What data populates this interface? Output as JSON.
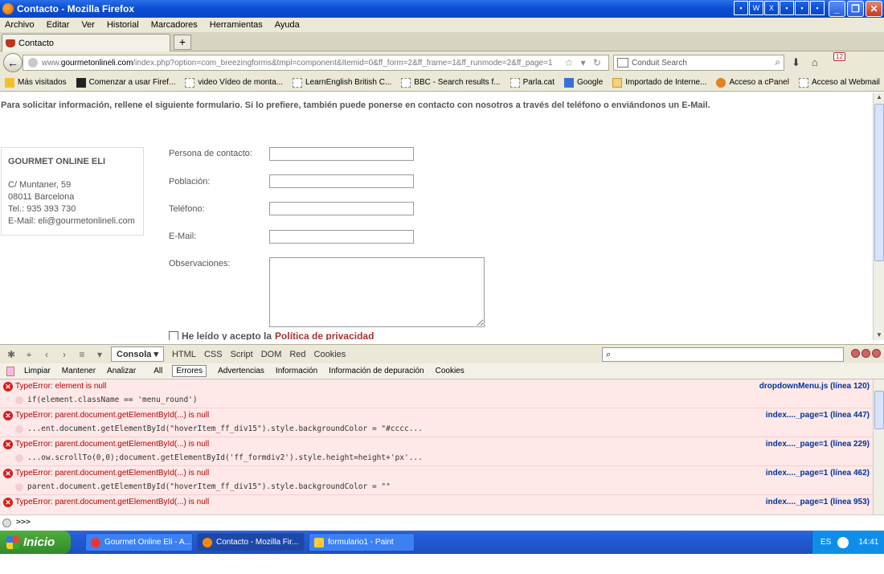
{
  "window": {
    "title": "Contacto - Mozilla Firefox"
  },
  "menu": [
    "Archivo",
    "Editar",
    "Ver",
    "Historial",
    "Marcadores",
    "Herramientas",
    "Ayuda"
  ],
  "tab": {
    "label": "Contacto",
    "new_tab_label": "+"
  },
  "address": {
    "prefix": "www.",
    "domain": "gourmetonlineli.com",
    "path": "/index.php?option=com_breezingforms&tmpl=component&Itemid=0&ff_form=2&ff_frame=1&ff_runmode=2&ff_page=1",
    "search_placeholder": "Conduit Search",
    "badge": "12"
  },
  "bookmarks": [
    {
      "label": "Más visitados",
      "icon": "star"
    },
    {
      "label": "Comenzar a usar Firef...",
      "icon": "m"
    },
    {
      "label": "video Vídeo de monta...",
      "icon": "page"
    },
    {
      "label": "LearnEnglish  British C...",
      "icon": "page"
    },
    {
      "label": "BBC - Search results f...",
      "icon": "page"
    },
    {
      "label": "Parla.cat",
      "icon": "page"
    },
    {
      "label": "Google",
      "icon": "g"
    },
    {
      "label": "Importado de Interne...",
      "icon": "folder"
    },
    {
      "label": "Acceso a cPanel",
      "icon": "cp"
    },
    {
      "label": "Acceso al Webmail",
      "icon": "page"
    }
  ],
  "page": {
    "intro": "Para solicitar información, rellene el siguiente formulario. Si lo prefiere, también puede ponerse en contacto con nosotros  a través del teléfono o enviándonos un E-Mail.",
    "company": {
      "name": "GOURMET ONLINE ELI",
      "address": "C/ Muntaner, 59",
      "city": "08011 Barcelona",
      "phone": "Tel.: 935 393 730",
      "email": "E-Mail: eli@gourmetonlineli.com"
    },
    "form": {
      "contact_label": "Persona de contacto:",
      "town_label": "Población:",
      "phone_label": "Teléfono:",
      "email_label": "E-Mail:",
      "notes_label": "Observaciones:",
      "privacy_text": "He leído y acepto la",
      "privacy_link": "Política de privacidad"
    }
  },
  "firebug": {
    "tabs": [
      "Consola",
      "HTML",
      "CSS",
      "Script",
      "DOM",
      "Red",
      "Cookies"
    ],
    "active_tab": "Consola",
    "subtoolbar": [
      "Limpiar",
      "Mantener",
      "Analizar",
      "All",
      "Errores",
      "Advertencias",
      "Información",
      "Información de depuración",
      "Cookies"
    ],
    "active_filter": "Errores",
    "errors": [
      {
        "message": "TypeError: element is null",
        "source": "dropdownMenu.js (línea 120)",
        "code": "if(element.className == 'menu_round')"
      },
      {
        "message": "TypeError: parent.document.getElementById(...) is null",
        "source": "index...._page=1 (línea 447)",
        "code": "...ent.document.getElementById(\"hoverItem_ff_div15\").style.backgroundColor = \"#cccc..."
      },
      {
        "message": "TypeError: parent.document.getElementById(...) is null",
        "source": "index...._page=1 (línea 229)",
        "code": "...ow.scrollTo(0,0);document.getElementById('ff_formdiv2').style.height=height+'px'..."
      },
      {
        "message": "TypeError: parent.document.getElementById(...) is null",
        "source": "index...._page=1 (línea 462)",
        "code": "parent.document.getElementById(\"hoverItem_ff_div15\").style.backgroundColor = \"\""
      },
      {
        "message": "TypeError: parent.document.getElementById(...) is null",
        "source": "index...._page=1 (línea 953)",
        "code": ""
      }
    ],
    "prompt": ">>>"
  },
  "taskbar": {
    "start": "Inicio",
    "tasks": [
      {
        "label": "Gourmet Online Eli - A...",
        "active": false
      },
      {
        "label": "Contacto - Mozilla Fir...",
        "active": true
      },
      {
        "label": "formulario1 - Paint",
        "active": false
      }
    ],
    "lang": "ES",
    "clock": "14:41"
  }
}
